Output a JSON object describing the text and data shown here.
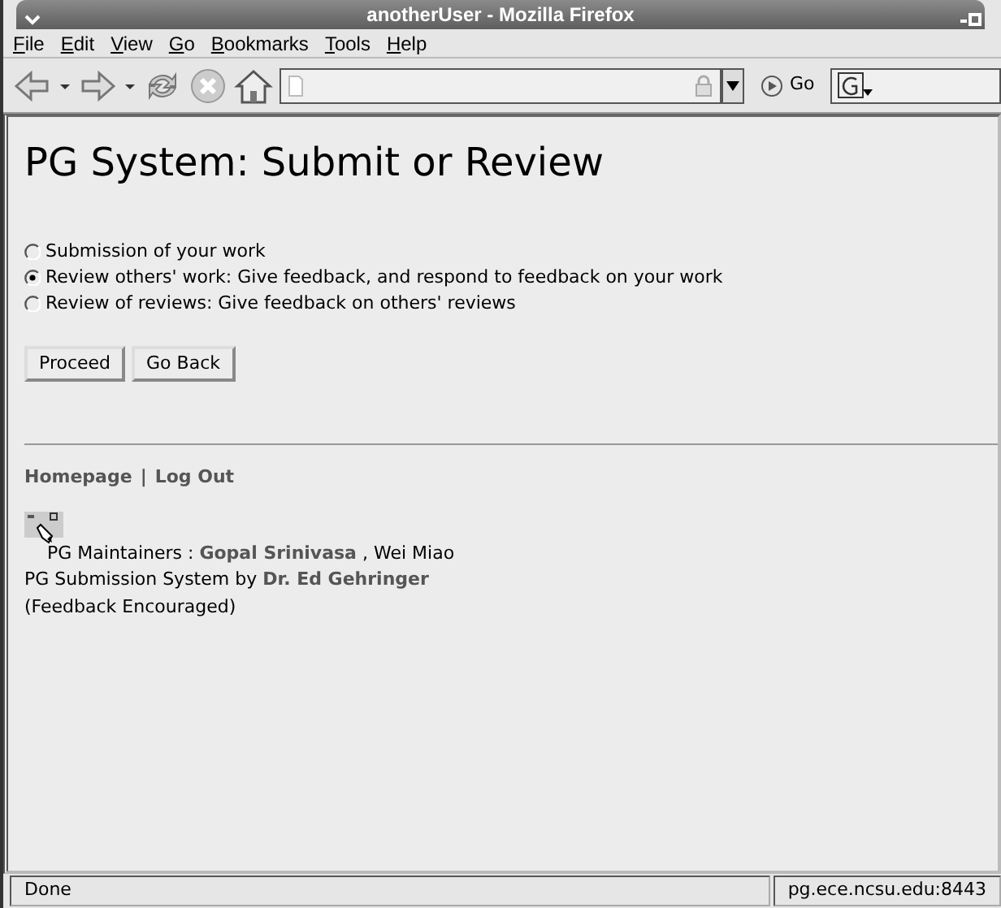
{
  "window": {
    "title": "anotherUser - Mozilla Firefox"
  },
  "menu": [
    {
      "label": "File"
    },
    {
      "label": "Edit"
    },
    {
      "label": "View"
    },
    {
      "label": "Go"
    },
    {
      "label": "Bookmarks"
    },
    {
      "label": "Tools"
    },
    {
      "label": "Help"
    }
  ],
  "toolbar": {
    "go_label": "Go"
  },
  "page": {
    "heading": "PG System: Submit or Review",
    "options": [
      {
        "label": "Submission of your work",
        "selected": false
      },
      {
        "label": "Review others' work: Give feedback, and respond to feedback on your work",
        "selected": true
      },
      {
        "label": "Review of reviews: Give feedback on others' reviews",
        "selected": false
      }
    ],
    "buttons": [
      "Proceed",
      "Go Back"
    ],
    "footer_links": [
      "Homepage",
      "Log Out"
    ],
    "link_separator": "|",
    "maintainers": {
      "prefix": "PG Maintainers :",
      "link": "Gopal Srinivasa",
      "suffix": ", Wei Miao"
    },
    "credit": {
      "prefix": "PG Submission System by",
      "link": "Dr. Ed Gehringer"
    },
    "note": "(Feedback Encouraged)"
  },
  "status_bar": {
    "text": "Done",
    "host": "pg.ece.ncsu.edu:8443"
  }
}
